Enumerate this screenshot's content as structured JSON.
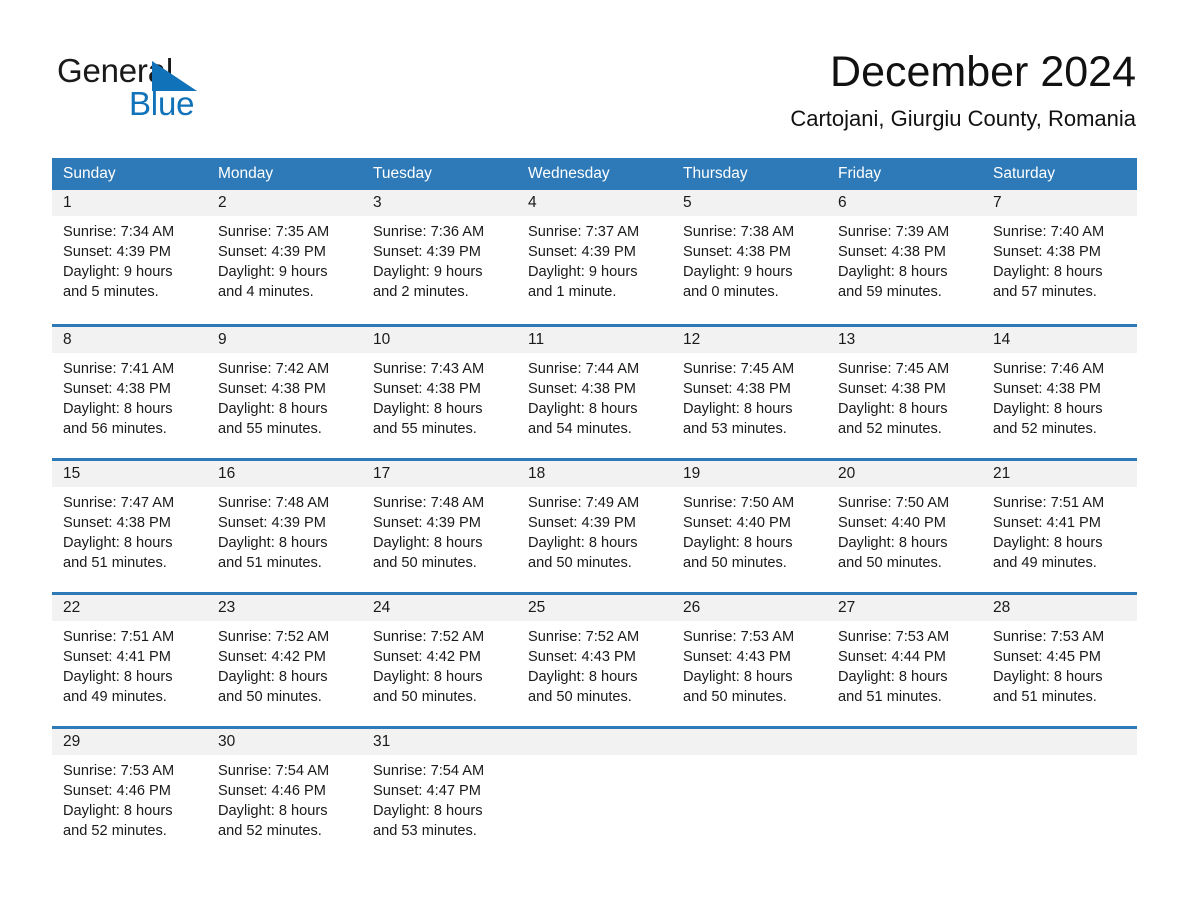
{
  "brand": {
    "name_part1": "General",
    "name_part2": "Blue",
    "triangle_icon": "triangle-icon",
    "color_primary": "#1072b8",
    "color_text": "#1a1a1a"
  },
  "header": {
    "title": "December 2024",
    "subtitle": "Cartojani, Giurgiu County, Romania"
  },
  "calendar": {
    "header_bg": "#2e7ab8",
    "row_border": "#2e7ab8",
    "day_band_bg": "#f2f2f2",
    "weekdays": [
      "Sunday",
      "Monday",
      "Tuesday",
      "Wednesday",
      "Thursday",
      "Friday",
      "Saturday"
    ],
    "weeks": [
      [
        {
          "day": "1",
          "sunrise": "Sunrise: 7:34 AM",
          "sunset": "Sunset: 4:39 PM",
          "daylight_line1": "Daylight: 9 hours",
          "daylight_line2": "and 5 minutes."
        },
        {
          "day": "2",
          "sunrise": "Sunrise: 7:35 AM",
          "sunset": "Sunset: 4:39 PM",
          "daylight_line1": "Daylight: 9 hours",
          "daylight_line2": "and 4 minutes."
        },
        {
          "day": "3",
          "sunrise": "Sunrise: 7:36 AM",
          "sunset": "Sunset: 4:39 PM",
          "daylight_line1": "Daylight: 9 hours",
          "daylight_line2": "and 2 minutes."
        },
        {
          "day": "4",
          "sunrise": "Sunrise: 7:37 AM",
          "sunset": "Sunset: 4:39 PM",
          "daylight_line1": "Daylight: 9 hours",
          "daylight_line2": "and 1 minute."
        },
        {
          "day": "5",
          "sunrise": "Sunrise: 7:38 AM",
          "sunset": "Sunset: 4:38 PM",
          "daylight_line1": "Daylight: 9 hours",
          "daylight_line2": "and 0 minutes."
        },
        {
          "day": "6",
          "sunrise": "Sunrise: 7:39 AM",
          "sunset": "Sunset: 4:38 PM",
          "daylight_line1": "Daylight: 8 hours",
          "daylight_line2": "and 59 minutes."
        },
        {
          "day": "7",
          "sunrise": "Sunrise: 7:40 AM",
          "sunset": "Sunset: 4:38 PM",
          "daylight_line1": "Daylight: 8 hours",
          "daylight_line2": "and 57 minutes."
        }
      ],
      [
        {
          "day": "8",
          "sunrise": "Sunrise: 7:41 AM",
          "sunset": "Sunset: 4:38 PM",
          "daylight_line1": "Daylight: 8 hours",
          "daylight_line2": "and 56 minutes."
        },
        {
          "day": "9",
          "sunrise": "Sunrise: 7:42 AM",
          "sunset": "Sunset: 4:38 PM",
          "daylight_line1": "Daylight: 8 hours",
          "daylight_line2": "and 55 minutes."
        },
        {
          "day": "10",
          "sunrise": "Sunrise: 7:43 AM",
          "sunset": "Sunset: 4:38 PM",
          "daylight_line1": "Daylight: 8 hours",
          "daylight_line2": "and 55 minutes."
        },
        {
          "day": "11",
          "sunrise": "Sunrise: 7:44 AM",
          "sunset": "Sunset: 4:38 PM",
          "daylight_line1": "Daylight: 8 hours",
          "daylight_line2": "and 54 minutes."
        },
        {
          "day": "12",
          "sunrise": "Sunrise: 7:45 AM",
          "sunset": "Sunset: 4:38 PM",
          "daylight_line1": "Daylight: 8 hours",
          "daylight_line2": "and 53 minutes."
        },
        {
          "day": "13",
          "sunrise": "Sunrise: 7:45 AM",
          "sunset": "Sunset: 4:38 PM",
          "daylight_line1": "Daylight: 8 hours",
          "daylight_line2": "and 52 minutes."
        },
        {
          "day": "14",
          "sunrise": "Sunrise: 7:46 AM",
          "sunset": "Sunset: 4:38 PM",
          "daylight_line1": "Daylight: 8 hours",
          "daylight_line2": "and 52 minutes."
        }
      ],
      [
        {
          "day": "15",
          "sunrise": "Sunrise: 7:47 AM",
          "sunset": "Sunset: 4:38 PM",
          "daylight_line1": "Daylight: 8 hours",
          "daylight_line2": "and 51 minutes."
        },
        {
          "day": "16",
          "sunrise": "Sunrise: 7:48 AM",
          "sunset": "Sunset: 4:39 PM",
          "daylight_line1": "Daylight: 8 hours",
          "daylight_line2": "and 51 minutes."
        },
        {
          "day": "17",
          "sunrise": "Sunrise: 7:48 AM",
          "sunset": "Sunset: 4:39 PM",
          "daylight_line1": "Daylight: 8 hours",
          "daylight_line2": "and 50 minutes."
        },
        {
          "day": "18",
          "sunrise": "Sunrise: 7:49 AM",
          "sunset": "Sunset: 4:39 PM",
          "daylight_line1": "Daylight: 8 hours",
          "daylight_line2": "and 50 minutes."
        },
        {
          "day": "19",
          "sunrise": "Sunrise: 7:50 AM",
          "sunset": "Sunset: 4:40 PM",
          "daylight_line1": "Daylight: 8 hours",
          "daylight_line2": "and 50 minutes."
        },
        {
          "day": "20",
          "sunrise": "Sunrise: 7:50 AM",
          "sunset": "Sunset: 4:40 PM",
          "daylight_line1": "Daylight: 8 hours",
          "daylight_line2": "and 50 minutes."
        },
        {
          "day": "21",
          "sunrise": "Sunrise: 7:51 AM",
          "sunset": "Sunset: 4:41 PM",
          "daylight_line1": "Daylight: 8 hours",
          "daylight_line2": "and 49 minutes."
        }
      ],
      [
        {
          "day": "22",
          "sunrise": "Sunrise: 7:51 AM",
          "sunset": "Sunset: 4:41 PM",
          "daylight_line1": "Daylight: 8 hours",
          "daylight_line2": "and 49 minutes."
        },
        {
          "day": "23",
          "sunrise": "Sunrise: 7:52 AM",
          "sunset": "Sunset: 4:42 PM",
          "daylight_line1": "Daylight: 8 hours",
          "daylight_line2": "and 50 minutes."
        },
        {
          "day": "24",
          "sunrise": "Sunrise: 7:52 AM",
          "sunset": "Sunset: 4:42 PM",
          "daylight_line1": "Daylight: 8 hours",
          "daylight_line2": "and 50 minutes."
        },
        {
          "day": "25",
          "sunrise": "Sunrise: 7:52 AM",
          "sunset": "Sunset: 4:43 PM",
          "daylight_line1": "Daylight: 8 hours",
          "daylight_line2": "and 50 minutes."
        },
        {
          "day": "26",
          "sunrise": "Sunrise: 7:53 AM",
          "sunset": "Sunset: 4:43 PM",
          "daylight_line1": "Daylight: 8 hours",
          "daylight_line2": "and 50 minutes."
        },
        {
          "day": "27",
          "sunrise": "Sunrise: 7:53 AM",
          "sunset": "Sunset: 4:44 PM",
          "daylight_line1": "Daylight: 8 hours",
          "daylight_line2": "and 51 minutes."
        },
        {
          "day": "28",
          "sunrise": "Sunrise: 7:53 AM",
          "sunset": "Sunset: 4:45 PM",
          "daylight_line1": "Daylight: 8 hours",
          "daylight_line2": "and 51 minutes."
        }
      ],
      [
        {
          "day": "29",
          "sunrise": "Sunrise: 7:53 AM",
          "sunset": "Sunset: 4:46 PM",
          "daylight_line1": "Daylight: 8 hours",
          "daylight_line2": "and 52 minutes."
        },
        {
          "day": "30",
          "sunrise": "Sunrise: 7:54 AM",
          "sunset": "Sunset: 4:46 PM",
          "daylight_line1": "Daylight: 8 hours",
          "daylight_line2": "and 52 minutes."
        },
        {
          "day": "31",
          "sunrise": "Sunrise: 7:54 AM",
          "sunset": "Sunset: 4:47 PM",
          "daylight_line1": "Daylight: 8 hours",
          "daylight_line2": "and 53 minutes."
        },
        {
          "day": "",
          "sunrise": "",
          "sunset": "",
          "daylight_line1": "",
          "daylight_line2": ""
        },
        {
          "day": "",
          "sunrise": "",
          "sunset": "",
          "daylight_line1": "",
          "daylight_line2": ""
        },
        {
          "day": "",
          "sunrise": "",
          "sunset": "",
          "daylight_line1": "",
          "daylight_line2": ""
        },
        {
          "day": "",
          "sunrise": "",
          "sunset": "",
          "daylight_line1": "",
          "daylight_line2": ""
        }
      ]
    ]
  }
}
